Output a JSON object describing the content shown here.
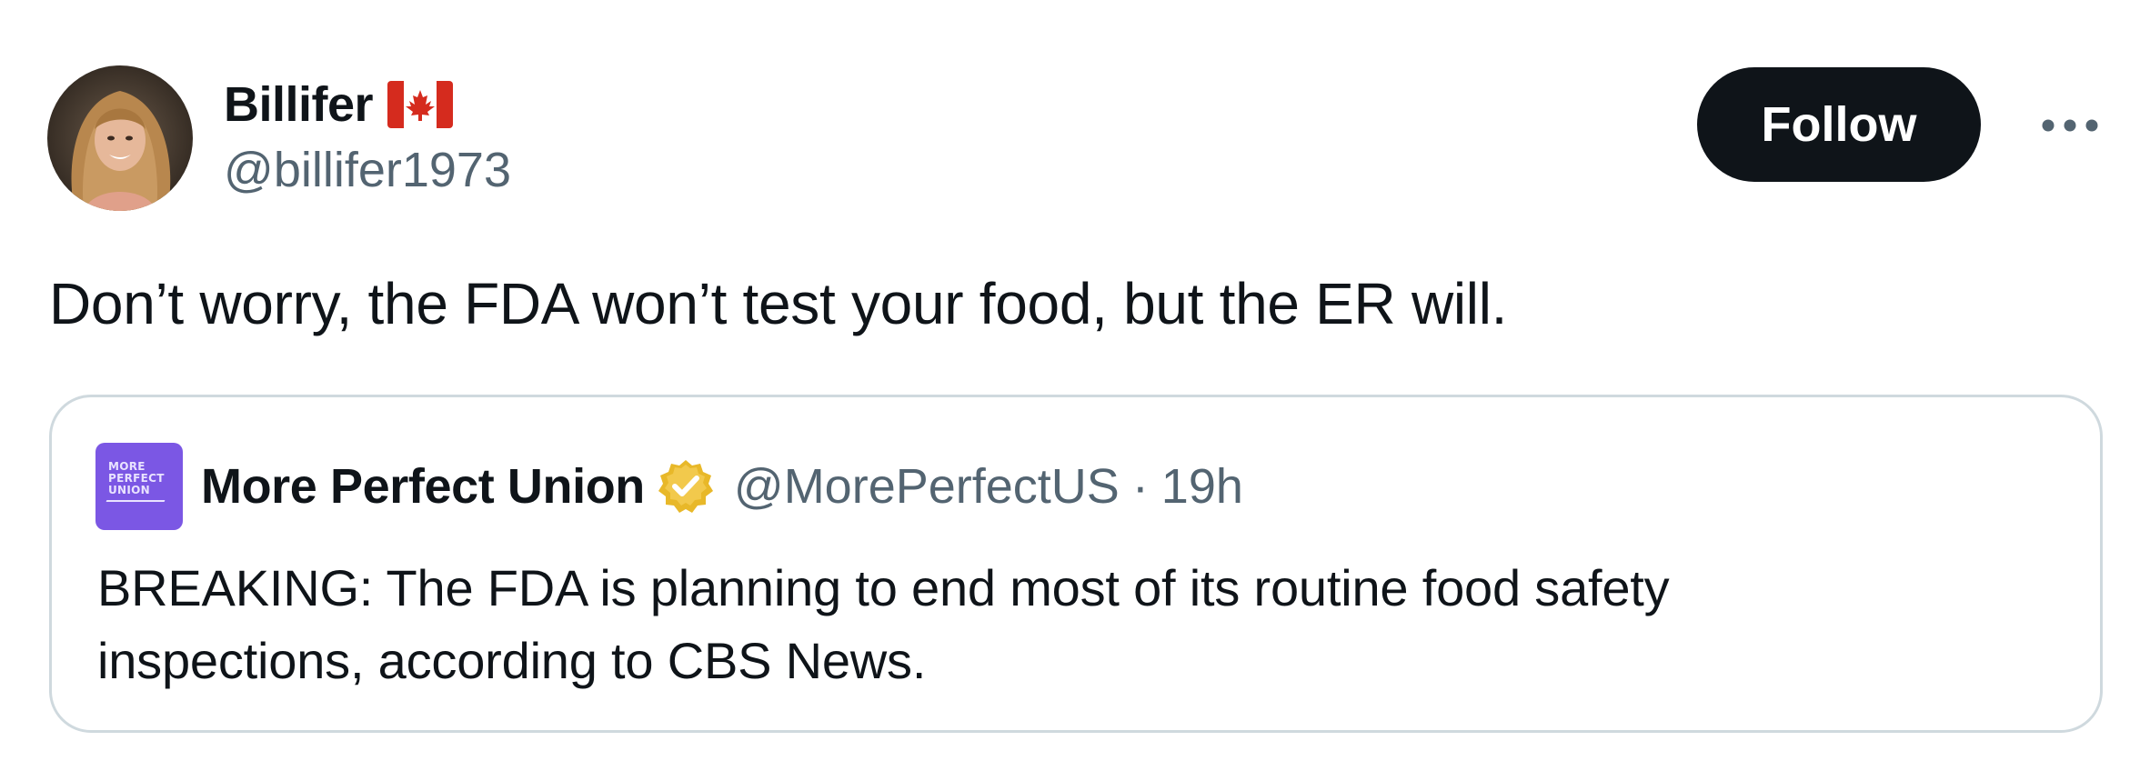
{
  "tweet": {
    "author": {
      "display_name": "Billifer",
      "flag_icon": "canada-flag-icon",
      "handle": "@billifer1973"
    },
    "follow_label": "Follow",
    "more_icon": "more-dots-icon",
    "text": "Don’t worry, the FDA won’t test your food, but the ER will."
  },
  "quote": {
    "avatar_logo_lines": [
      "MORE",
      "PERFECT",
      "UNION"
    ],
    "author_name": "More Perfect Union",
    "verified_icon": "verified-badge-icon",
    "handle": "@MorePerfectUS",
    "separator": "·",
    "time": "19h",
    "text_lines": [
      "BREAKING: The FDA is planning to end most of its routine food safety",
      "inspections, according to CBS News."
    ]
  },
  "colors": {
    "text_primary": "#0f1419",
    "text_secondary": "#536471",
    "follow_bg": "#0f1419",
    "card_border": "#cfd9de",
    "verified_gold": "#e8b829",
    "mpu_purple": "#7b57e4"
  }
}
